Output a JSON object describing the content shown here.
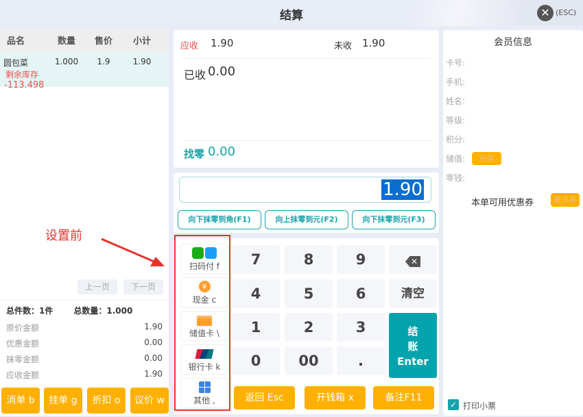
{
  "header": {
    "title": "结算",
    "esc": "(ESC)"
  },
  "table": {
    "headers": [
      "品名",
      "数量",
      "售价",
      "小计"
    ],
    "rows": [
      {
        "name": "圆包菜",
        "qty": "1.000",
        "price": "1.9",
        "subtotal": "1.90",
        "stock_label": "剩余库存",
        "stock_value": "-113.498"
      }
    ]
  },
  "pager": {
    "prev": "上一页",
    "next": "下一页"
  },
  "summary": {
    "total_items": "总件数：1件",
    "total_qty": "总数量：1.000",
    "rows": [
      {
        "label": "原价金额",
        "value": "1.90"
      },
      {
        "label": "优惠金额",
        "value": "0.00"
      },
      {
        "label": "抹零金额",
        "value": "0.00"
      },
      {
        "label": "应收金额",
        "value": "1.90"
      }
    ]
  },
  "left_actions": [
    "消单 b",
    "挂单 g",
    "折扣 o",
    "议价 w"
  ],
  "payment": {
    "receivable_label": "应收",
    "receivable": "1.90",
    "unpaid_label": "未收",
    "unpaid": "1.90",
    "received_label": "已收",
    "received": "0.00",
    "change_label": "找零",
    "change": "0.00"
  },
  "input": {
    "value": "1.90"
  },
  "rounding": [
    "向下抹零到角(F1)",
    "向上抹零到元(F2)",
    "向下抹零到元(F3)"
  ],
  "pay_methods": [
    "扫码付 f",
    "现金 c",
    "储值卡 \\",
    "银行卡 k",
    "其他 ,"
  ],
  "keys": [
    "7",
    "8",
    "9",
    "4",
    "5",
    "6",
    "1",
    "2",
    "3",
    "0",
    "00",
    "."
  ],
  "clear": "清空",
  "checkout": [
    "结",
    "账",
    "Enter"
  ],
  "bottom_actions": [
    "返回 Esc",
    "开钱箱 x",
    "备注F11"
  ],
  "member": {
    "title": "会员信息",
    "fields": [
      "卡号:",
      "手机:",
      "姓名:",
      "等级:",
      "积分:",
      "储值:",
      "零钱:"
    ],
    "recharge": "充值",
    "coupon_label": "本单可用优惠券",
    "more_coupons": "更多券",
    "print_receipt": "打印小票"
  },
  "annotation": {
    "text": "设置前"
  },
  "colors": {
    "accent": "#03a3ad",
    "orange": "#ffb000",
    "red": "#ef4f4f"
  }
}
